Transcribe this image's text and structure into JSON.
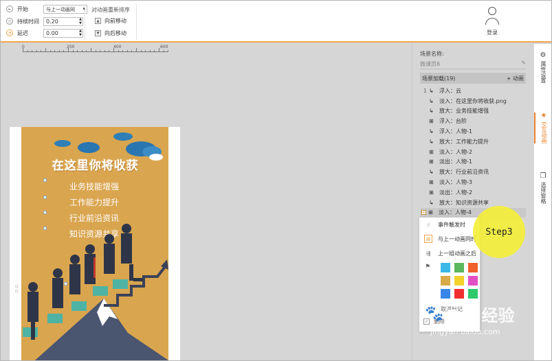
{
  "toolbar": {
    "start_label": "开始",
    "start_value": "与上一动画同",
    "duration_label": "持续时间",
    "duration_value": "0.20",
    "delay_label": "延迟",
    "delay_value": "0.00",
    "reorder_title": "对动画重新排序",
    "move_forward": "向前移动",
    "move_backward": "向后移动",
    "login_label": "登录"
  },
  "ruler": {
    "labels": [
      "0",
      "200",
      "400",
      "600"
    ]
  },
  "slide": {
    "title": "在这里你将收获",
    "bullets": [
      "业务技能增强",
      "工作能力提升",
      "行业前沿资讯",
      "知识资源共享"
    ]
  },
  "panel": {
    "scene_label": "场景名称:",
    "scene_name": "微课页8",
    "load_label": "场景加载(19)",
    "add_anim": "+ 动画",
    "items": [
      {
        "num": "1",
        "icon": "float-in-icon",
        "glyph": "↳",
        "text": "浮入：云"
      },
      {
        "num": "",
        "icon": "fade-in-icon",
        "glyph": "↳",
        "text": "淡入：在这里你将收获.png"
      },
      {
        "num": "",
        "icon": "zoom-in-icon",
        "glyph": "↳",
        "text": "放大：业务技能增强"
      },
      {
        "num": "",
        "icon": "timeline-icon",
        "glyph": "⊞",
        "text": "浮入：台阶"
      },
      {
        "num": "",
        "icon": "float-in-icon",
        "glyph": "↳",
        "text": "浮入：人物-1"
      },
      {
        "num": "",
        "icon": "zoom-in-icon",
        "glyph": "↳",
        "text": "放大：工作能力提升"
      },
      {
        "num": "",
        "icon": "timeline-icon",
        "glyph": "⊞",
        "text": "淡入：人物-2"
      },
      {
        "num": "",
        "icon": "timeline-icon",
        "glyph": "⊞",
        "text": "淡出：人物-1"
      },
      {
        "num": "",
        "icon": "zoom-in-icon",
        "glyph": "↳",
        "text": "放大：行业前沿资讯"
      },
      {
        "num": "",
        "icon": "timeline-icon",
        "glyph": "⊞",
        "text": "淡入：人物-3"
      },
      {
        "num": "",
        "icon": "timeline-icon",
        "glyph": "⊞",
        "text": "淡出：人物-2"
      },
      {
        "num": "",
        "icon": "zoom-in-icon",
        "glyph": "↳",
        "text": "放大：知识资源共享"
      },
      {
        "num": "",
        "icon": "timeline-icon",
        "glyph": "⊞",
        "text": "淡入：人物-4"
      }
    ]
  },
  "menu": {
    "event_trigger": "事件触发时",
    "with_previous": "与上一动画同时",
    "after_previous": "上一组动画之后",
    "clear_mark": "取消标记",
    "last_item": "删除",
    "swatches": [
      "#3ab8e8",
      "#5cb85c",
      "#f0602c",
      "#d9aa48",
      "#f5d22a",
      "#e24fc4",
      "#3a86e8",
      "#f03030",
      "#2ec96a"
    ]
  },
  "step_label": "Step3",
  "sidetabs": {
    "properties": "属性设置",
    "interactive": "交互动画",
    "select_grid": "选择窗格"
  },
  "watermark": {
    "brand": "Bai 经验",
    "url": "jingyan.baidu.com"
  }
}
